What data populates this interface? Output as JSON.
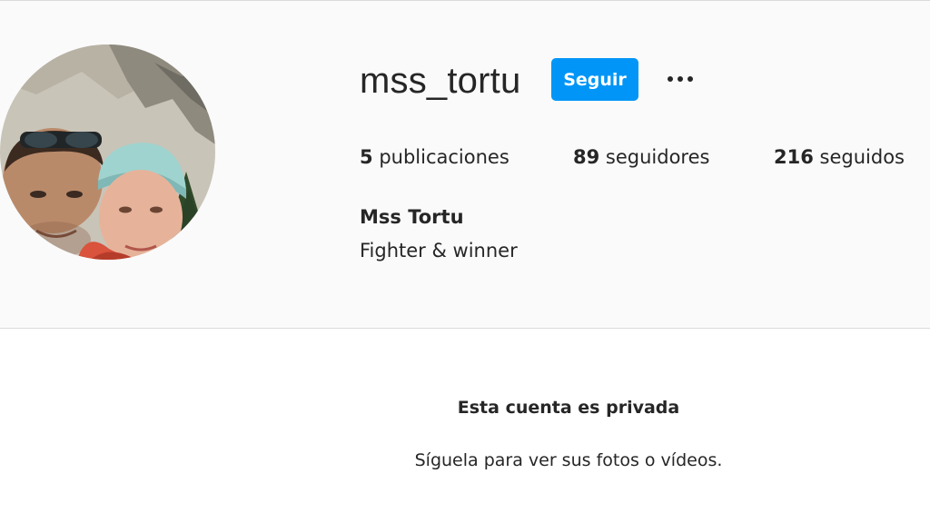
{
  "profile": {
    "username": "mss_tortu",
    "follow_label": "Seguir",
    "more_options_icon": "more-horizontal-icon",
    "full_name": "Mss Tortu",
    "bio": "Fighter & winner"
  },
  "stats": {
    "posts": {
      "count": "5",
      "label": "publicaciones"
    },
    "followers": {
      "count": "89",
      "label": "seguidores"
    },
    "following": {
      "count": "216",
      "label": "seguidos"
    }
  },
  "private_notice": {
    "title": "Esta cuenta es privada",
    "subtitle": "Síguela para ver sus fotos o vídeos."
  },
  "colors": {
    "follow_button": "#0095f6",
    "header_background": "#fafafa",
    "text": "#262626",
    "border": "#dbdbdb"
  }
}
